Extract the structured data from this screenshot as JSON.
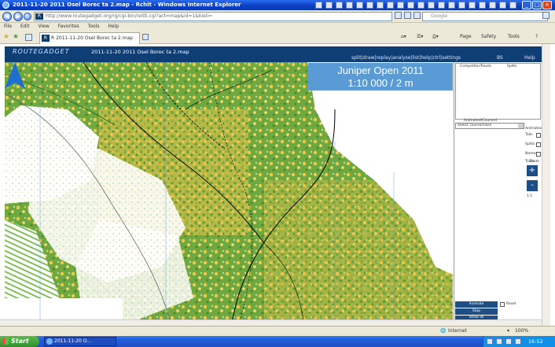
{
  "window": {
    "title": "2011-11-20 2011 Osel Borec ta 2.map - Rchit - Windows Internet Explorer"
  },
  "address_bar": {
    "url": "http://www.routegadget.org/rg/cgi-bin/reitti.cgi?act=map&id=1&kieli=",
    "search_placeholder": "Google"
  },
  "menu": [
    "File",
    "Edit",
    "View",
    "Favorites",
    "Tools",
    "Help"
  ],
  "tab": {
    "label": "R 2011-11-20 Osel Borec ta 2.map"
  },
  "command_bar": {
    "home": "Home",
    "page": "Page",
    "safety": "Safety",
    "tools": "Tools",
    "help": "?"
  },
  "routegadget": {
    "logo": "ROUTEGADGET",
    "event_title": "2011-11-20 2011 Osel Borec ta 2.map",
    "nav_links": "split|draw|replay|analyse|list|help|ctrl|settings",
    "bs_link": "BS",
    "help_link": "Help",
    "map_label_line1": "Juniper Open 2011",
    "map_label_line2": "1:10 000 / 2 m"
  },
  "sidebar": {
    "col_left_header": "Competitor/Route",
    "col_right_header": "Splits",
    "section_header": "Animated/Coursed",
    "select_value": "Select course/class",
    "options_label": "Animation",
    "option1": "Tails",
    "option2": "Splits",
    "option3": "Names",
    "option4": "Trails",
    "zoom_label": "Zoom",
    "zoom_in": "+",
    "zoom_out": "-",
    "zoom_value": "1:1",
    "btn1": "Animate",
    "btn2": "Stop",
    "btn3": "Show all",
    "btn1_right": "Reset"
  },
  "status_bar": {
    "zone": "Internet",
    "zoom": "100%"
  },
  "taskbar": {
    "start": "Start",
    "task_label": "2011-11-20 O...",
    "clock": "16:52"
  }
}
